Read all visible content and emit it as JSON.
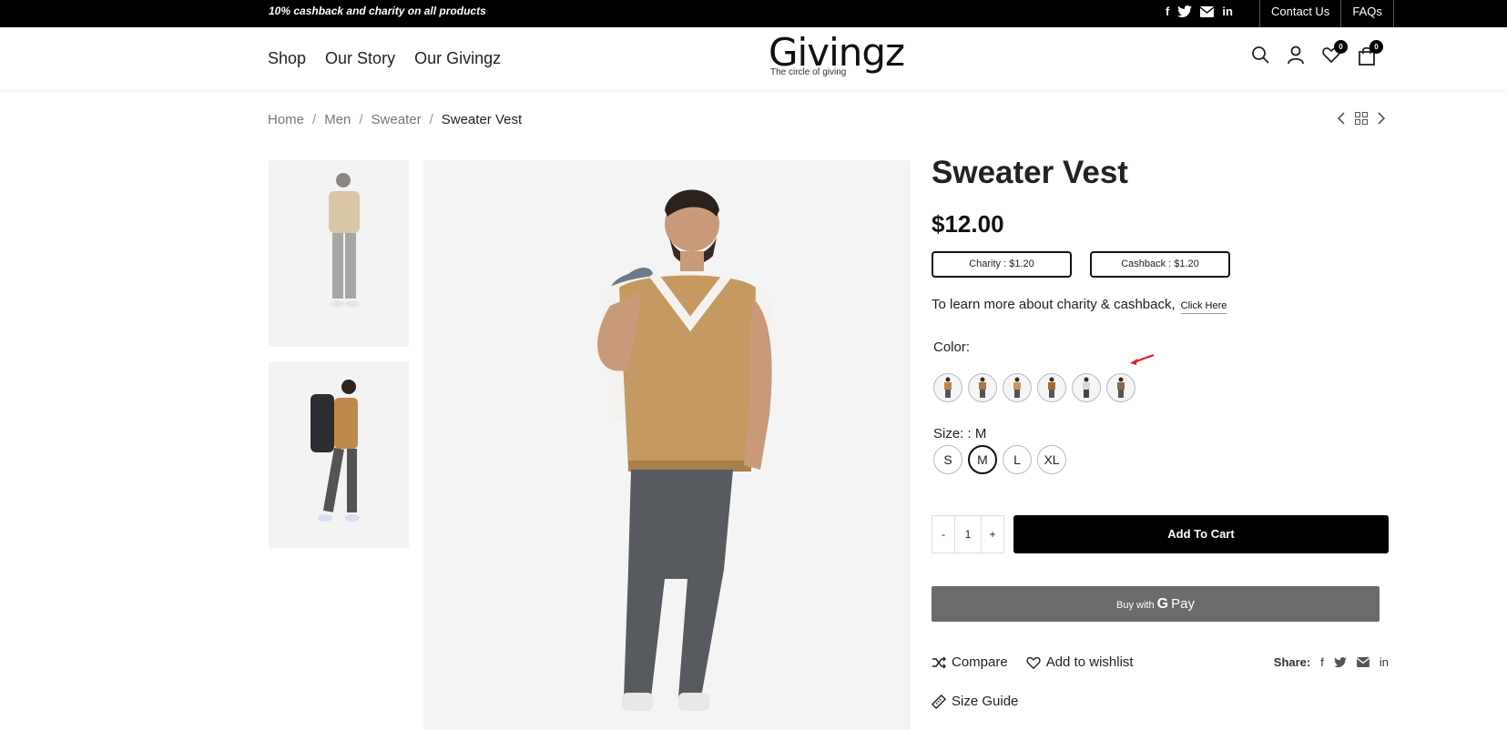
{
  "topbar": {
    "promo": "10% cashback and charity on all products",
    "social_icons": [
      "facebook-icon",
      "twitter-icon",
      "email-icon",
      "linkedin-icon"
    ],
    "links": [
      "Contact Us",
      "FAQs"
    ]
  },
  "header": {
    "nav": [
      "Shop",
      "Our Story",
      "Our Givingz"
    ],
    "logo": {
      "word": "Givingz",
      "tagline": "The circle of giving"
    },
    "wishlist_count": "0",
    "cart_count": "0"
  },
  "breadcrumb": {
    "items": [
      "Home",
      "Men",
      "Sweater"
    ],
    "current": "Sweater Vest"
  },
  "product": {
    "title": "Sweater Vest",
    "price": "$12.00",
    "charity": "Charity : $1.20",
    "cashback": "Cashback : $1.20",
    "learn_text": "To learn more about charity & cashback,",
    "learn_link": "Click Here",
    "color_label": "Color:",
    "size_label": "Size:",
    "size_selected": ": M",
    "sizes": [
      "S",
      "M",
      "L",
      "XL"
    ],
    "quantity": "1",
    "qty_minus": "-",
    "qty_plus": "+",
    "add_to_cart": "Add To Cart",
    "gpay_prefix": "Buy with",
    "gpay_suffix": "Pay",
    "compare": "Compare",
    "wishlist": "Add to wishlist",
    "share_label": "Share:",
    "size_guide": "Size Guide"
  },
  "colors": {
    "accent": "#000000",
    "arrow": "#e02020",
    "gpay": "#6b6b6b"
  }
}
